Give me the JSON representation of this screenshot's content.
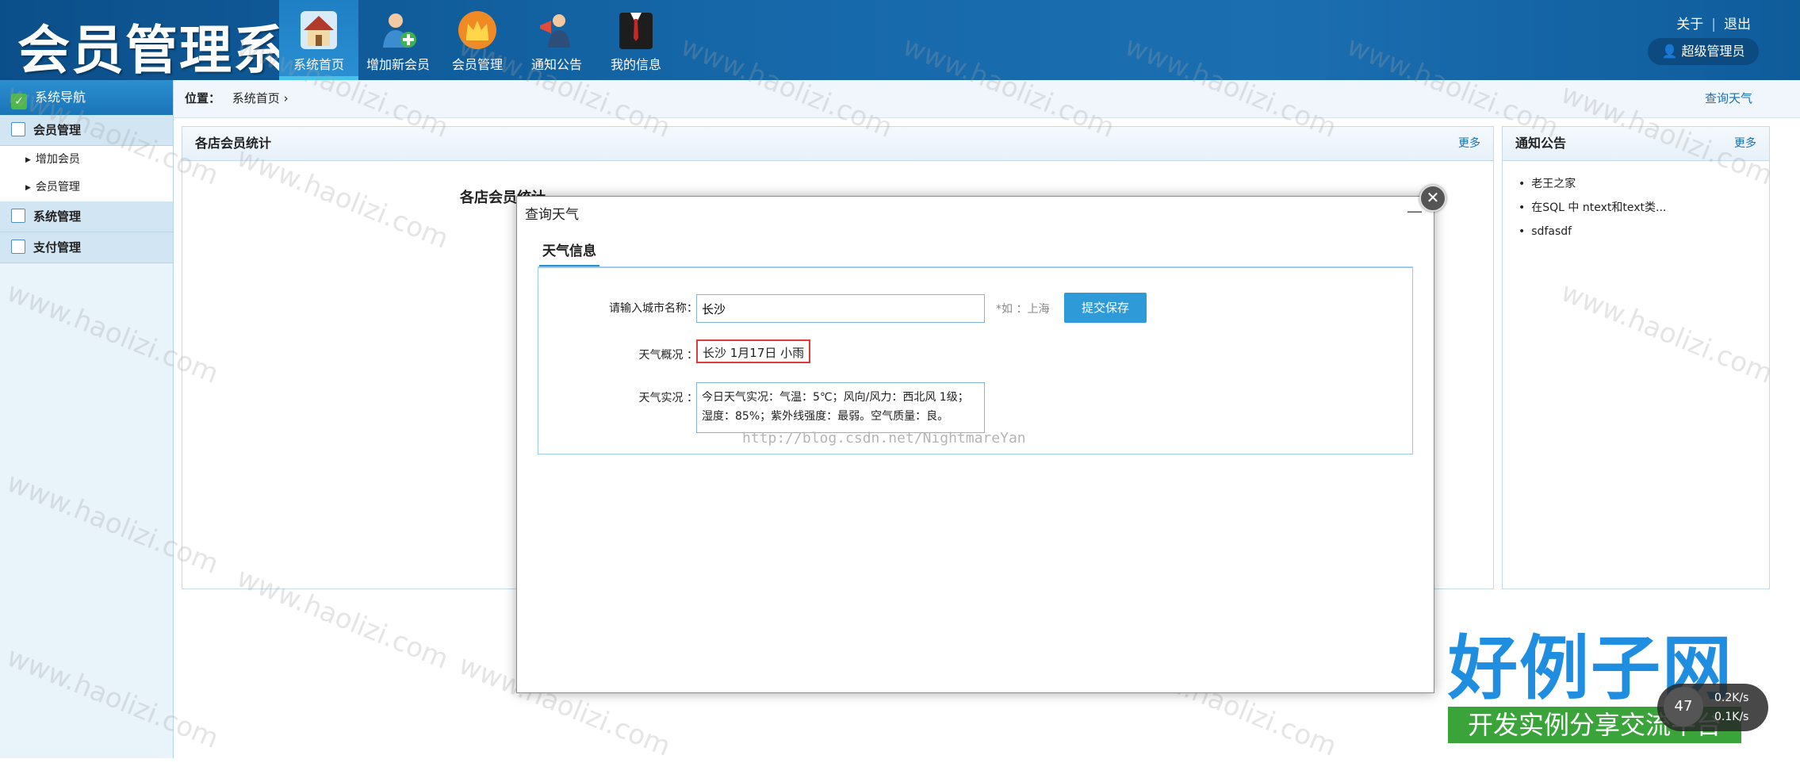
{
  "header": {
    "app_title": "会员管理系统",
    "nav": [
      {
        "label": "系统首页",
        "icon": "house-icon"
      },
      {
        "label": "增加新会员",
        "icon": "add-user-icon"
      },
      {
        "label": "会员管理",
        "icon": "crown-icon"
      },
      {
        "label": "通知公告",
        "icon": "megaphone-icon"
      },
      {
        "label": "我的信息",
        "icon": "suit-icon"
      }
    ],
    "about": "关于",
    "logout": "退出",
    "user": "超级管理员"
  },
  "sidebar": {
    "title": "系统导航",
    "groups": [
      {
        "label": "会员管理",
        "items": [
          "增加会员",
          "会员管理"
        ]
      },
      {
        "label": "系统管理"
      },
      {
        "label": "支付管理"
      }
    ]
  },
  "breadcrumb": {
    "label": "位置：",
    "path": "系统首页 ›",
    "weather_link": "查询天气"
  },
  "stats_panel": {
    "title": "各店会员统计",
    "more": "更多",
    "chart_title": "各店会员统计"
  },
  "notice_panel": {
    "title": "通知公告",
    "more": "更多",
    "items": [
      "老王之家",
      "在SQL 中 ntext和text类...",
      "sdfasdf"
    ]
  },
  "dialog": {
    "title": "查询天气",
    "tab": "天气信息",
    "city_label": "请输入城市名称：",
    "city_value": "长沙",
    "city_hint": "*如 ：上海",
    "submit": "提交保存",
    "summary_label": "天气概况 ：",
    "summary_value": "长沙 1月17日 小雨",
    "detail_label": "天气实况 ：",
    "detail_value": "今日天气实况：气温：5℃；风向/风力：西北风 1级；湿度：85%；紫外线强度：最弱。空气质量：良。",
    "close": "✕",
    "minimize": "—"
  },
  "overlay": {
    "csdn": "http://blog.csdn.net/NightmareYan",
    "watermark": "www.haolizi.com",
    "brand_main": "好例子网",
    "brand_sub": "开发实例分享交流平台",
    "speed_pct": "47",
    "speed_up": "0.2K/s",
    "speed_down": "0.1K/s"
  },
  "colors": {
    "header": "#1567a8",
    "accent": "#2f9ad8",
    "error_border": "#e23a3a",
    "brand_blue": "#1f8ee0",
    "brand_green": "#3aa33a"
  }
}
